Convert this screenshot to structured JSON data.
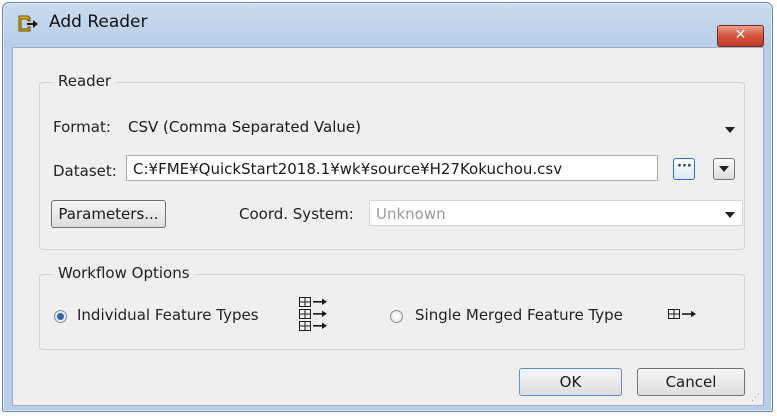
{
  "window": {
    "title": "Add Reader",
    "close_glyph": "✕"
  },
  "reader_group": {
    "label": "Reader",
    "format_label": "Format:",
    "format_value": "CSV (Comma Separated Value)",
    "dataset_label": "Dataset:",
    "dataset_value": "C:¥FME¥QuickStart2018.1¥wk¥source¥H27Kokuchou.csv",
    "browse_glyph": "···",
    "parameters_label": "Parameters...",
    "coord_label": "Coord. System:",
    "coord_value": "Unknown"
  },
  "workflow_group": {
    "label": "Workflow Options",
    "option1_label": "Individual Feature Types",
    "option1_checked": true,
    "option2_label": "Single Merged Feature Type",
    "option2_checked": false
  },
  "buttons": {
    "ok": "OK",
    "cancel": "Cancel"
  },
  "icons": {
    "title": "add-reader-icon",
    "multi_feature": "multiple-feature-types-icon",
    "single_feature": "single-feature-type-icon"
  }
}
